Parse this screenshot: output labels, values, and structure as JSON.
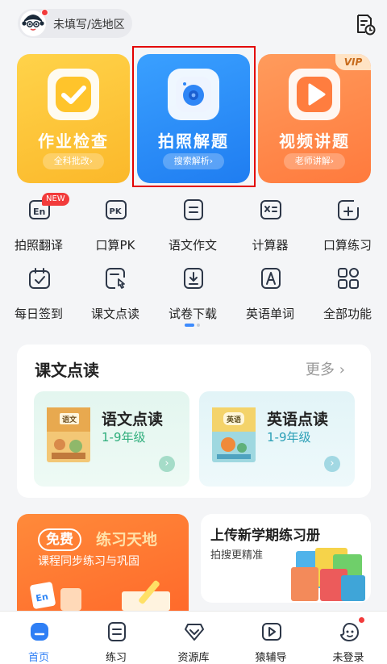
{
  "header": {
    "location_text": "未填写/选地区"
  },
  "feature_cards": [
    {
      "title": "作业检查",
      "pill": "全科批改›"
    },
    {
      "title": "拍照解题",
      "pill": "搜索解析›"
    },
    {
      "title": "视频讲题",
      "pill": "老师讲解›",
      "badge": "VIP"
    }
  ],
  "tools": [
    {
      "label": "拍照翻译",
      "badge": "NEW",
      "icon": "translate-icon"
    },
    {
      "label": "口算PK",
      "icon": "pk-icon"
    },
    {
      "label": "语文作文",
      "icon": "essay-icon"
    },
    {
      "label": "计算器",
      "icon": "calculator-icon"
    },
    {
      "label": "口算练习",
      "icon": "practice-icon"
    },
    {
      "label": "每日签到",
      "icon": "calendar-check-icon"
    },
    {
      "label": "课文点读",
      "icon": "touch-read-icon"
    },
    {
      "label": "试卷下载",
      "icon": "download-icon"
    },
    {
      "label": "英语单词",
      "icon": "letter-a-icon"
    },
    {
      "label": "全部功能",
      "icon": "grid-icon"
    }
  ],
  "reading": {
    "title": "课文点读",
    "more": "更多 ›",
    "items": [
      {
        "title": "语文点读",
        "grade": "1-9年级",
        "cover_text": "语文"
      },
      {
        "title": "英语点读",
        "grade": "1-9年级",
        "cover_text": "英语"
      }
    ]
  },
  "promo_left": {
    "tag": "免费",
    "head": "练习天地",
    "sub": "课程同步练习与巩固"
  },
  "promo_right": {
    "title": "上传新学期练习册",
    "sub": "拍搜更精准"
  },
  "tabbar": [
    {
      "label": "首页",
      "active": true
    },
    {
      "label": "练习"
    },
    {
      "label": "资源库"
    },
    {
      "label": "猿辅导"
    },
    {
      "label": "未登录"
    }
  ],
  "colors": {
    "accent": "#2f7ff5",
    "homework": "#fbb82a",
    "photo": "#1f7df1",
    "video": "#ff7a3d",
    "highlight_box": "#e30000"
  }
}
